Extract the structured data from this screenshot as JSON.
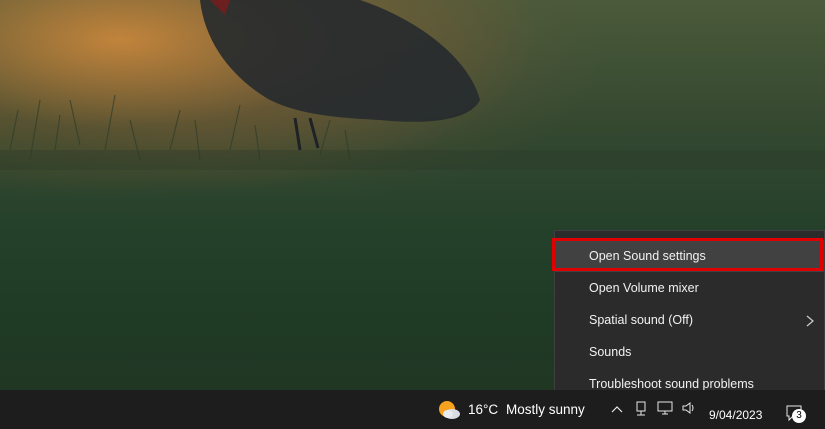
{
  "context_menu": {
    "items": [
      {
        "label": "Open Sound settings",
        "highlighted": true
      },
      {
        "label": "Open Volume mixer"
      },
      {
        "label": "Spatial sound (Off)",
        "has_submenu": true
      },
      {
        "label": "Sounds"
      },
      {
        "label": "Troubleshoot sound problems"
      }
    ]
  },
  "taskbar": {
    "weather": {
      "temp": "16°C",
      "condition": "Mostly sunny",
      "icon": "partly-sunny-icon"
    },
    "tray_icons": [
      "chevron-up-icon",
      "network-icon",
      "display-icon",
      "volume-icon"
    ],
    "date": "9/04/2023",
    "notification_count": "3"
  },
  "colors": {
    "highlight_border": "#e00000",
    "menu_bg": "#2b2b2b",
    "taskbar_bg": "#1c1d1c"
  }
}
